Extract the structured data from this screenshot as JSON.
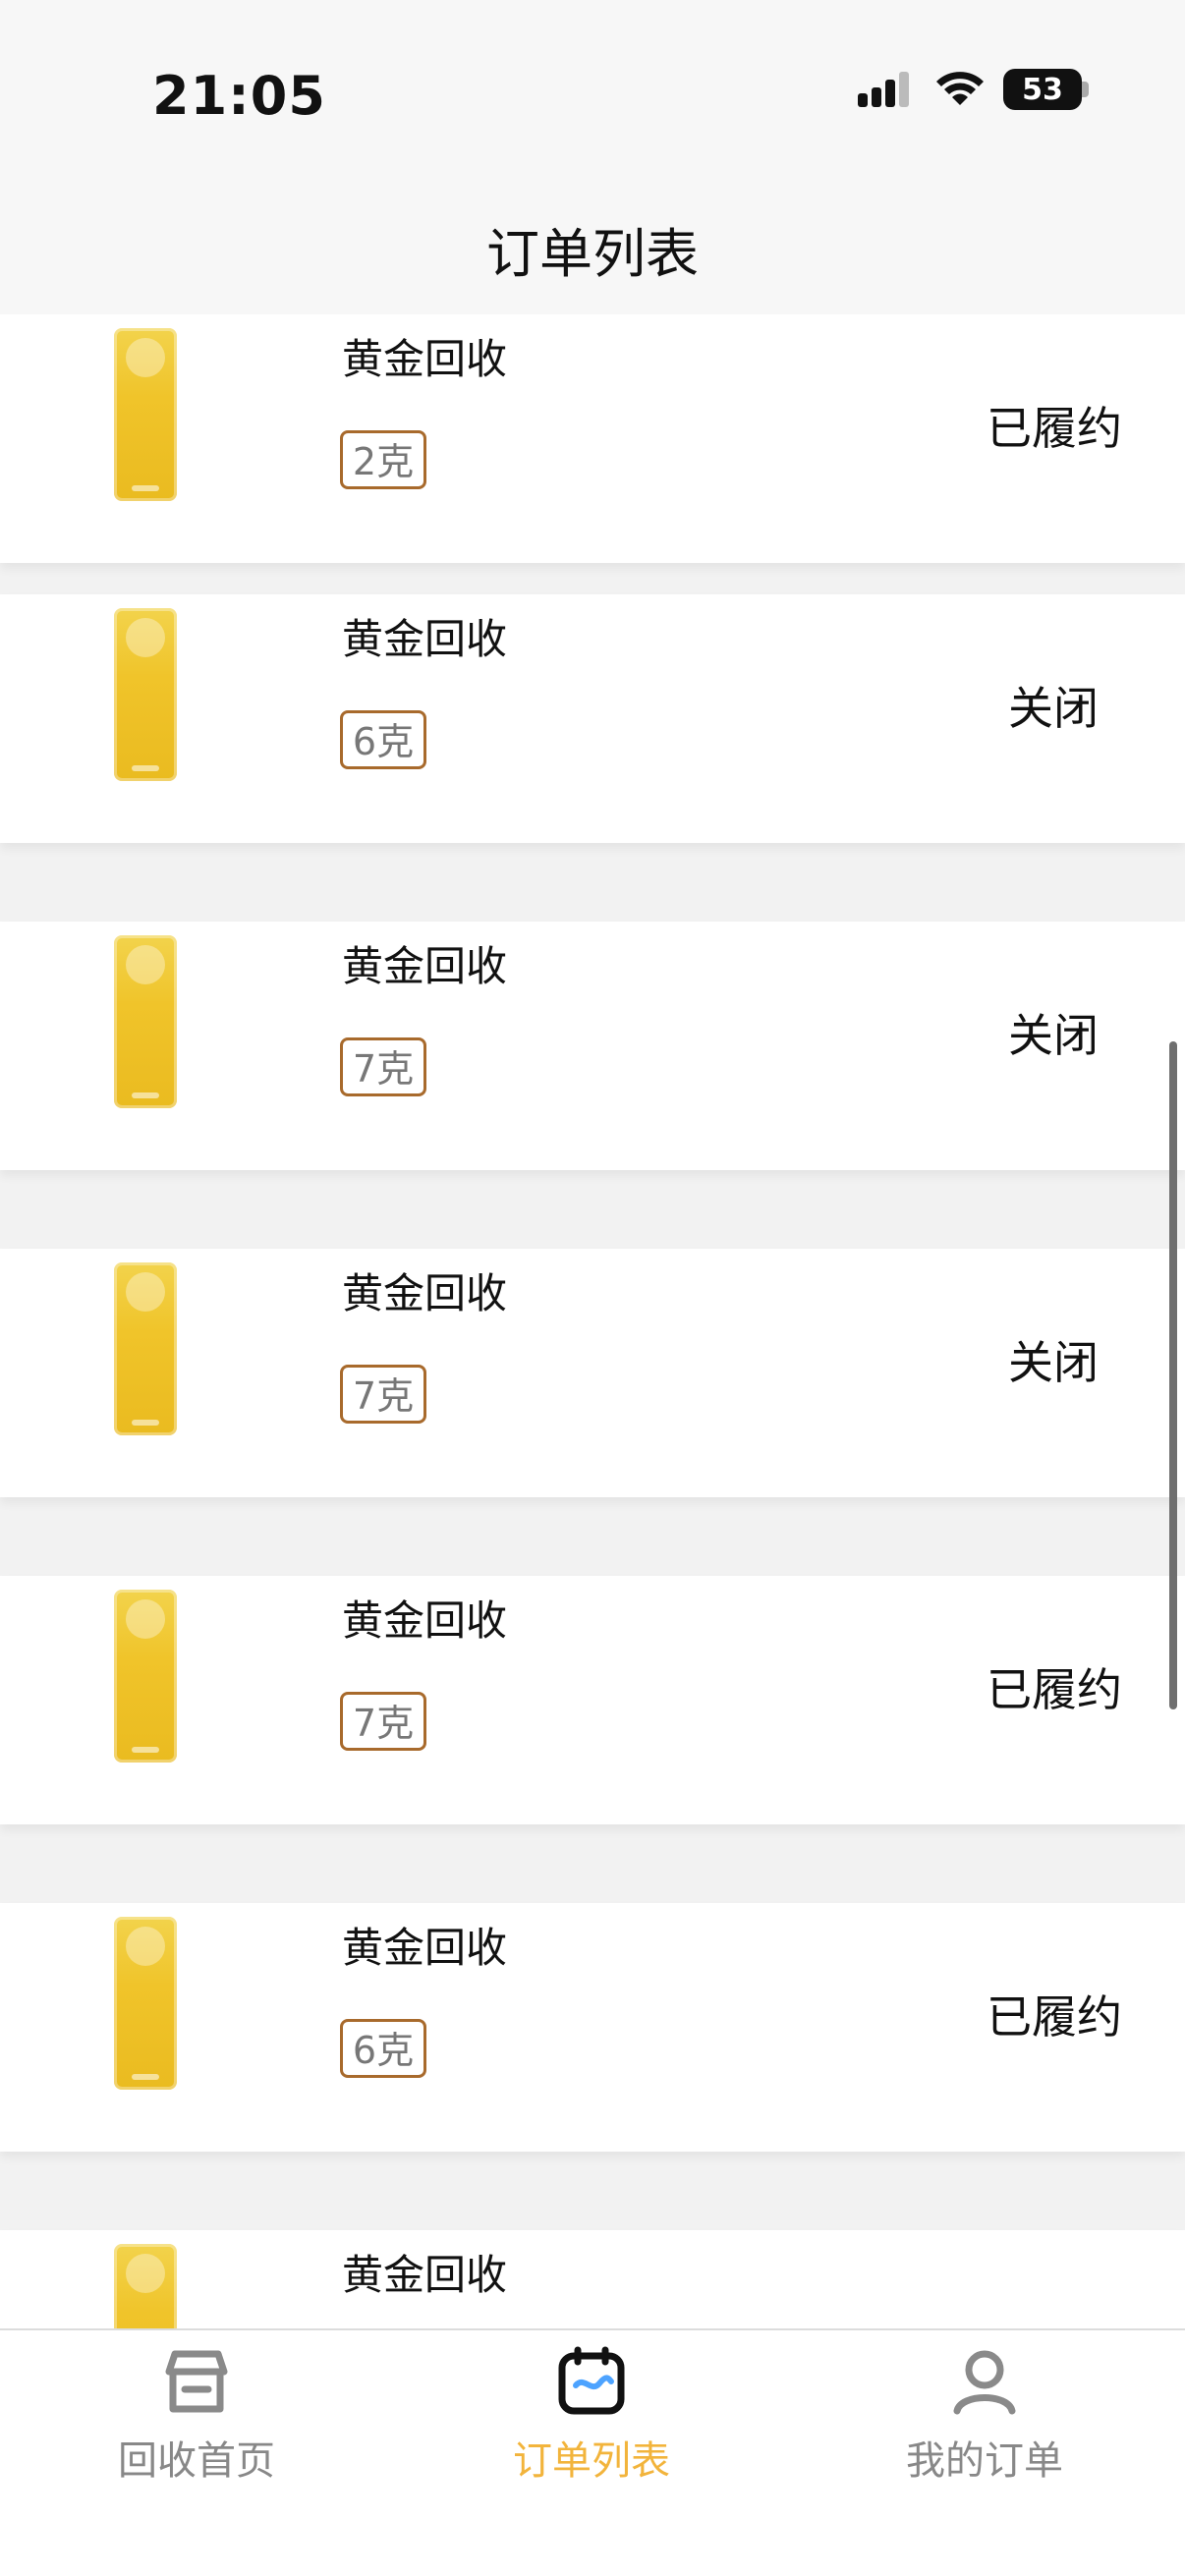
{
  "status_bar": {
    "time": "21:05",
    "battery_level": "53"
  },
  "header": {
    "title": "订单列表"
  },
  "orders": [
    {
      "name": "黄金回收",
      "weight": "2克",
      "status": "已履约"
    },
    {
      "name": "黄金回收",
      "weight": "6克",
      "status": "关闭"
    },
    {
      "name": "黄金回收",
      "weight": "7克",
      "status": "关闭"
    },
    {
      "name": "黄金回收",
      "weight": "7克",
      "status": "关闭"
    },
    {
      "name": "黄金回收",
      "weight": "7克",
      "status": "已履约"
    },
    {
      "name": "黄金回收",
      "weight": "6克",
      "status": "已履约"
    },
    {
      "name": "黄金回收",
      "weight": "",
      "status": ""
    }
  ],
  "tabs": [
    {
      "label": "回收首页",
      "icon": "store-icon"
    },
    {
      "label": "订单列表",
      "icon": "order-list-icon",
      "active": true
    },
    {
      "label": "我的订单",
      "icon": "profile-icon"
    }
  ],
  "colors": {
    "accent": "#f2b43c",
    "tag_border": "#a86a2c",
    "gold": "#f0c42a"
  }
}
